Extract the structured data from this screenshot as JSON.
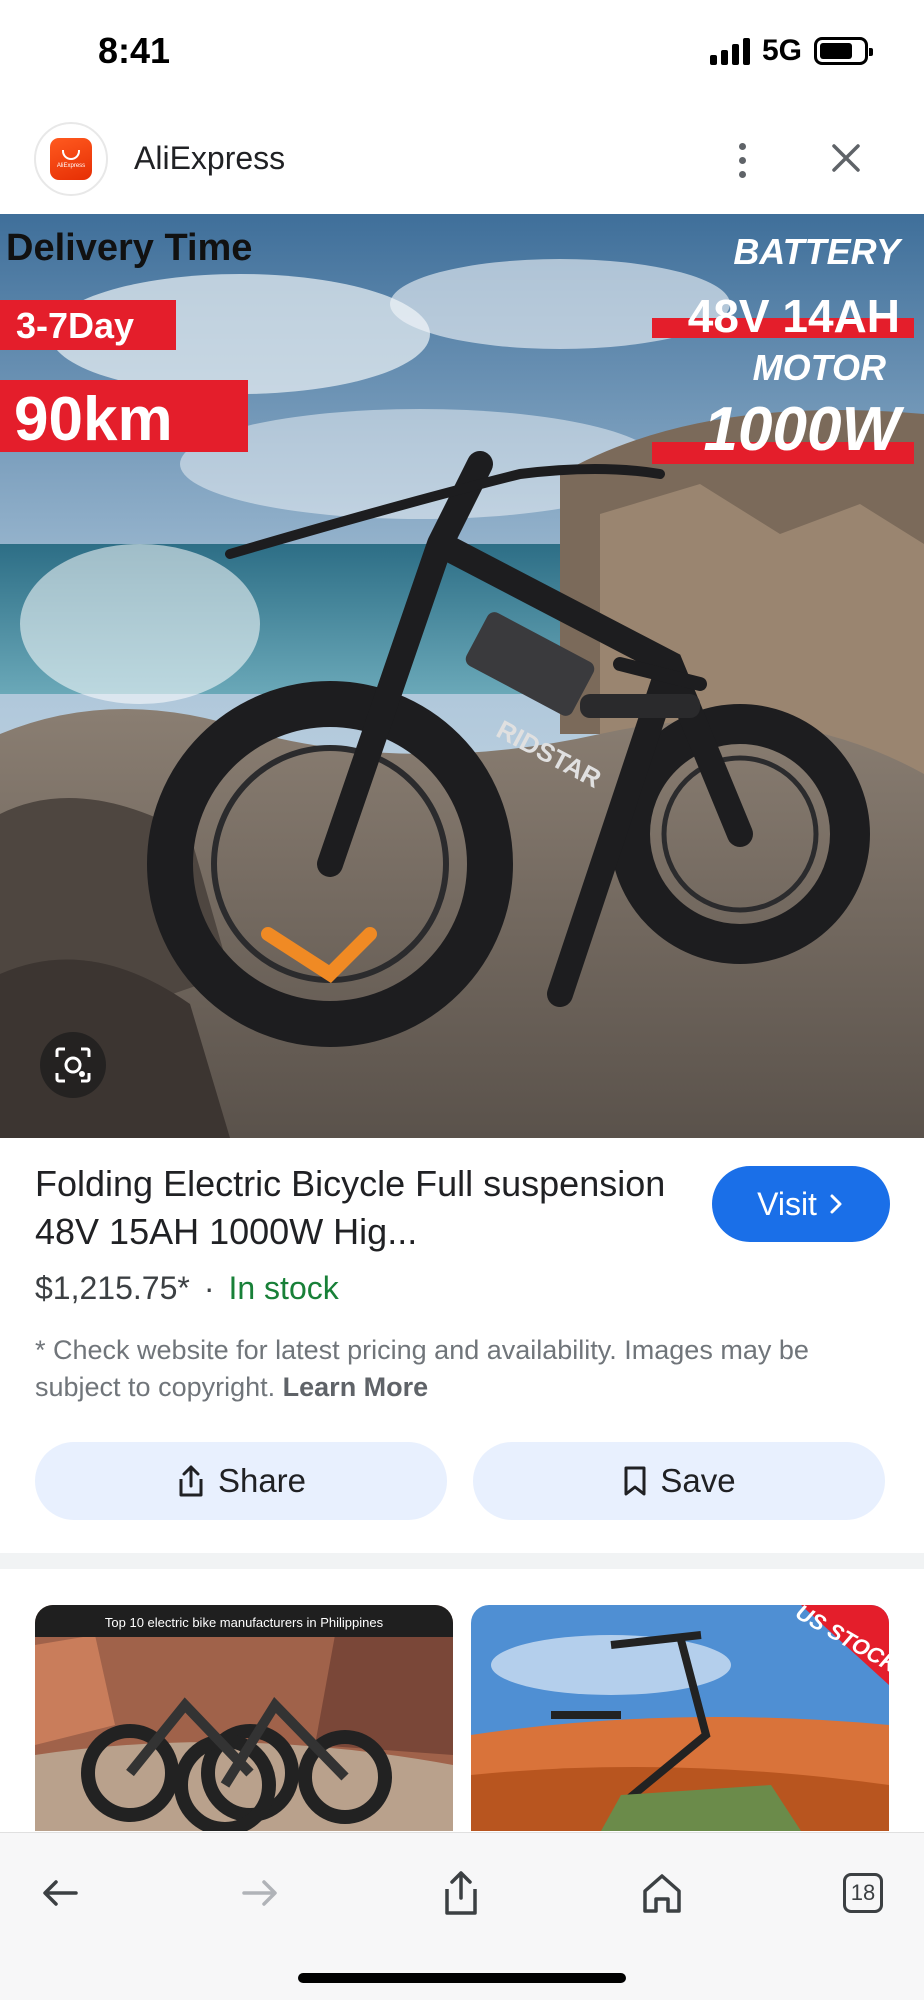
{
  "status_bar": {
    "time": "8:41",
    "network": "5G",
    "battery_level": 0.75
  },
  "header": {
    "site_name": "AliExpress",
    "logo_text": "AliExpress",
    "icons": [
      "more-vertical-icon",
      "close-icon"
    ]
  },
  "hero": {
    "delivery_label": "Delivery Time",
    "delivery_days": "3-7Day",
    "range": "90km",
    "battery_label": "BATTERY",
    "battery_value": "48V 14AH",
    "motor_label": "MOTOR",
    "motor_value": "1000W",
    "frame_brand": "RIDSTAR",
    "lens_icon": "visual-search-icon"
  },
  "product": {
    "title": "Folding Electric Bicycle Full suspension 48V 15AH 1000W Hig...",
    "visit_label": "Visit",
    "price": "$1,215.75*",
    "separator": "·",
    "stock_status": "In stock",
    "disclaimer": "* Check website for latest pricing and availability. Images may be subject to copyright.",
    "learn_more": "Learn More",
    "share_label": "Share",
    "save_label": "Save"
  },
  "related": [
    {
      "caption": "Top 10 electric bike manufacturers in Philippines"
    },
    {
      "badge": "US STOCK"
    }
  ],
  "toolbar": {
    "back_icon": "back-arrow-icon",
    "forward_icon": "forward-arrow-icon",
    "share_icon": "share-icon",
    "home_icon": "home-icon",
    "tab_count": "18"
  },
  "colors": {
    "accent_blue": "#1a6fe8",
    "stock_green": "#188038",
    "chip_bg": "#e8f0fe",
    "promo_red": "#e41e2b"
  }
}
